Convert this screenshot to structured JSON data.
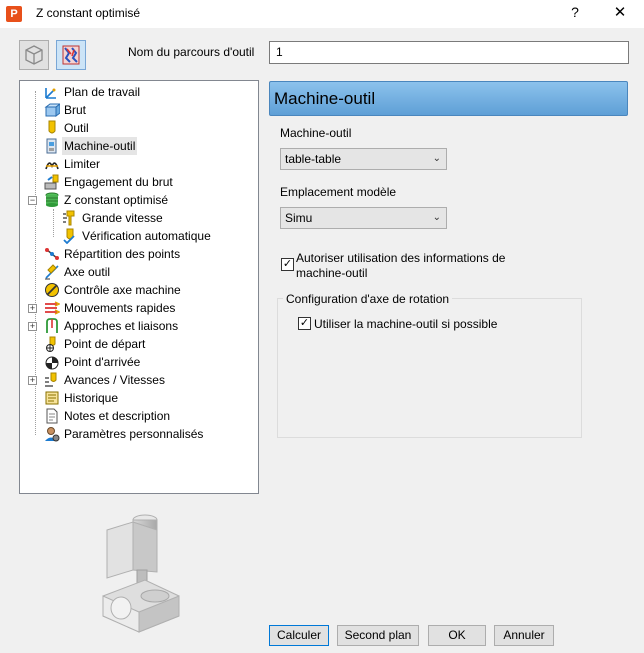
{
  "window": {
    "title": "Z constant optimisé",
    "help": "?",
    "close": "✕",
    "app_icon_letter": "P"
  },
  "toolbar": {
    "buttons": [
      {
        "icon": "toolpath-wire-icon"
      },
      {
        "icon": "toolpath-shaded-icon"
      }
    ]
  },
  "name_field": {
    "label": "Nom du parcours d'outil",
    "value": "1"
  },
  "tree": {
    "items": [
      {
        "label": "Plan de travail",
        "icon": "workplane-icon"
      },
      {
        "label": "Brut",
        "icon": "block-icon"
      },
      {
        "label": "Outil",
        "icon": "tool-icon"
      },
      {
        "label": "Machine-outil",
        "icon": "machine-tool-icon",
        "selected": true
      },
      {
        "label": "Limiter",
        "icon": "limit-icon"
      },
      {
        "label": "Engagement du brut",
        "icon": "stock-engagement-icon"
      },
      {
        "label": "Z constant optimisé",
        "icon": "constant-z-icon",
        "expanded": true
      },
      {
        "label": "Grande vitesse",
        "icon": "high-speed-icon",
        "child": true
      },
      {
        "label": "Vérification automatique",
        "icon": "auto-verify-icon",
        "child": true
      },
      {
        "label": "Répartition des points",
        "icon": "point-distribution-icon"
      },
      {
        "label": "Axe outil",
        "icon": "tool-axis-icon"
      },
      {
        "label": "Contrôle axe machine",
        "icon": "axis-control-icon"
      },
      {
        "label": "Mouvements rapides",
        "icon": "rapid-moves-icon",
        "collapsed": true
      },
      {
        "label": "Approches et liaisons",
        "icon": "leads-links-icon",
        "collapsed": true
      },
      {
        "label": "Point de départ",
        "icon": "start-point-icon"
      },
      {
        "label": "Point d'arrivée",
        "icon": "end-point-icon"
      },
      {
        "label": "Avances / Vitesses",
        "icon": "feeds-speeds-icon",
        "collapsed": true
      },
      {
        "label": "Historique",
        "icon": "history-icon"
      },
      {
        "label": "Notes et description",
        "icon": "notes-icon"
      },
      {
        "label": "Paramètres personnalisés",
        "icon": "user-parameters-icon"
      }
    ]
  },
  "panel": {
    "header": "Machine-outil",
    "machine_label": "Machine-outil",
    "machine_value": "table-table",
    "location_label": "Emplacement modèle",
    "location_value": "Simu",
    "allow_checkbox_label_line1": "Autoriser utilisation des informations de",
    "allow_checkbox_label_line2": "machine-outil",
    "allow_checked": true,
    "rotation_group_title": "Configuration d'axe de rotation",
    "use_machine_label": "Utiliser la machine-outil si possible",
    "use_machine_checked": true,
    "checkmark": "✓",
    "chevron": "⌄"
  },
  "buttons": {
    "calculate": "Calculer",
    "queue": "Second plan",
    "ok": "OK",
    "cancel": "Annuler"
  }
}
